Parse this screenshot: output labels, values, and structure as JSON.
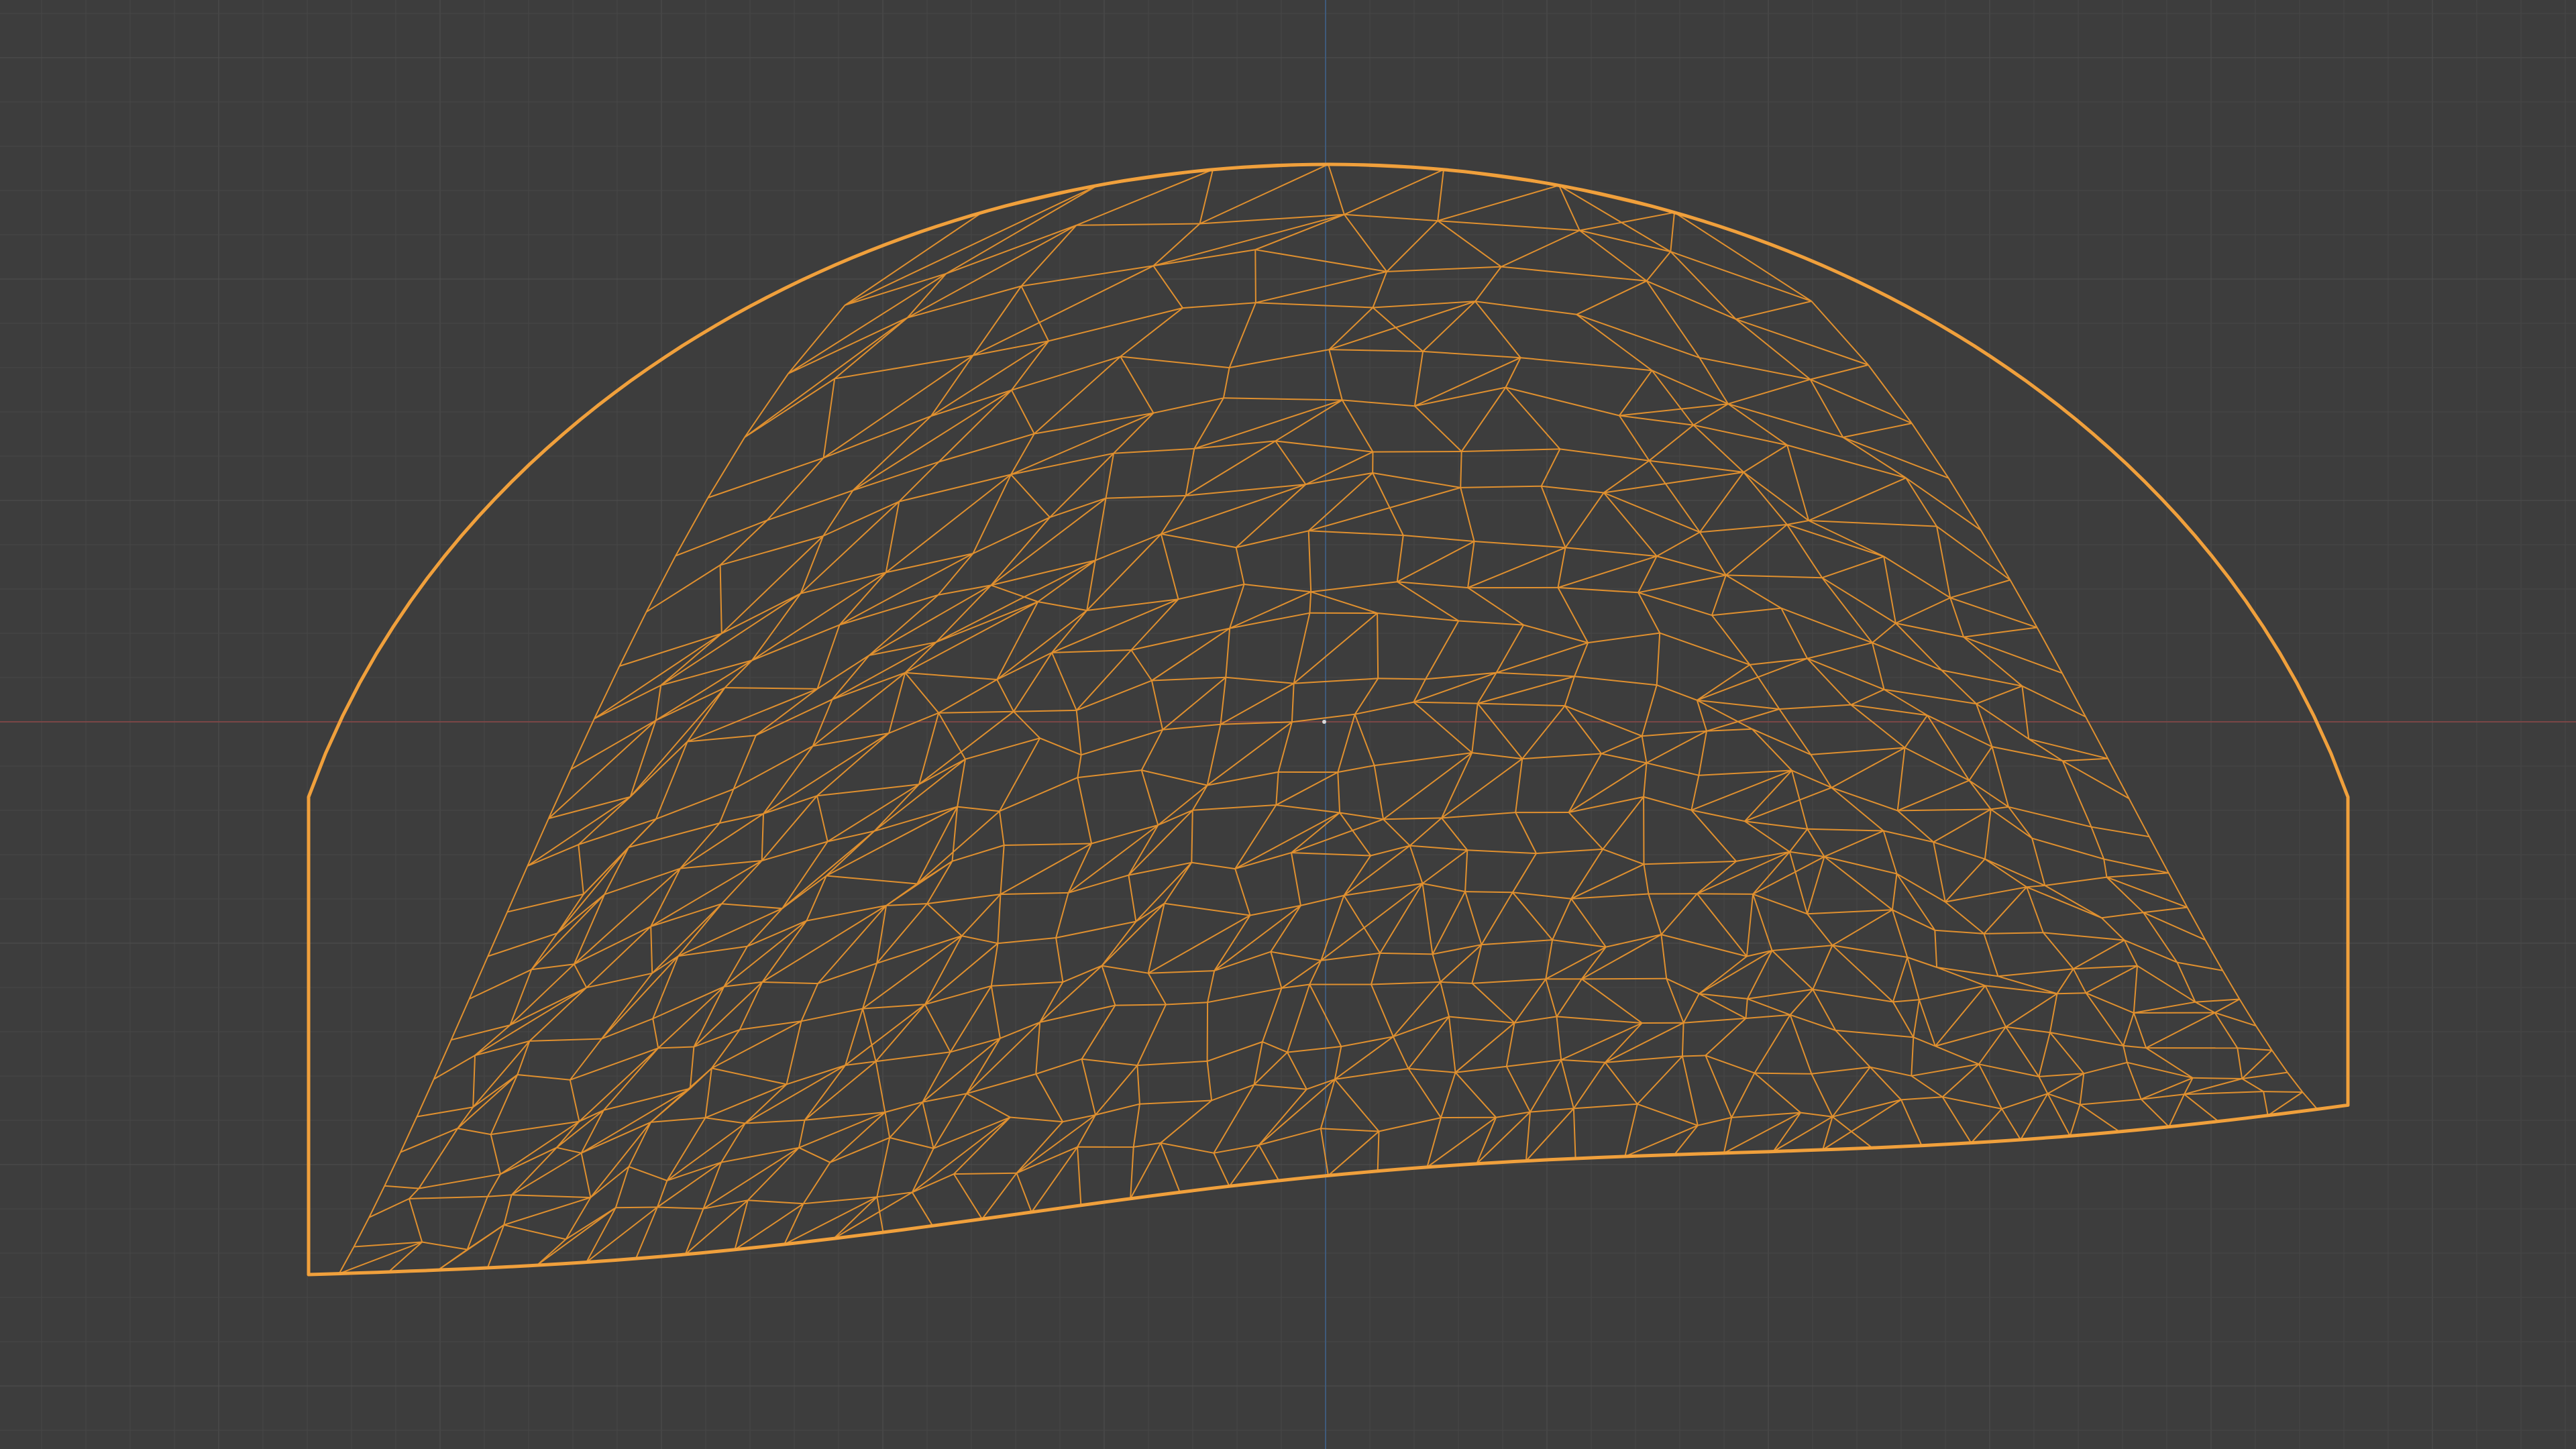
{
  "viewport": {
    "mode": "wireframe",
    "background_color": "#3d3d3d",
    "grid": {
      "visible": true,
      "minor_color": "#464646",
      "major_color": "#4e4e4e"
    },
    "axes": {
      "x_axis_color": "#7a4646",
      "y_axis_color": "#3f5a7a"
    }
  },
  "object": {
    "shape": "dome",
    "selected": true,
    "wire_color": "#e0902f",
    "outline_color": "#f0a03c"
  },
  "origin_dot": {
    "visible": true,
    "color": "#d8d8d8"
  }
}
